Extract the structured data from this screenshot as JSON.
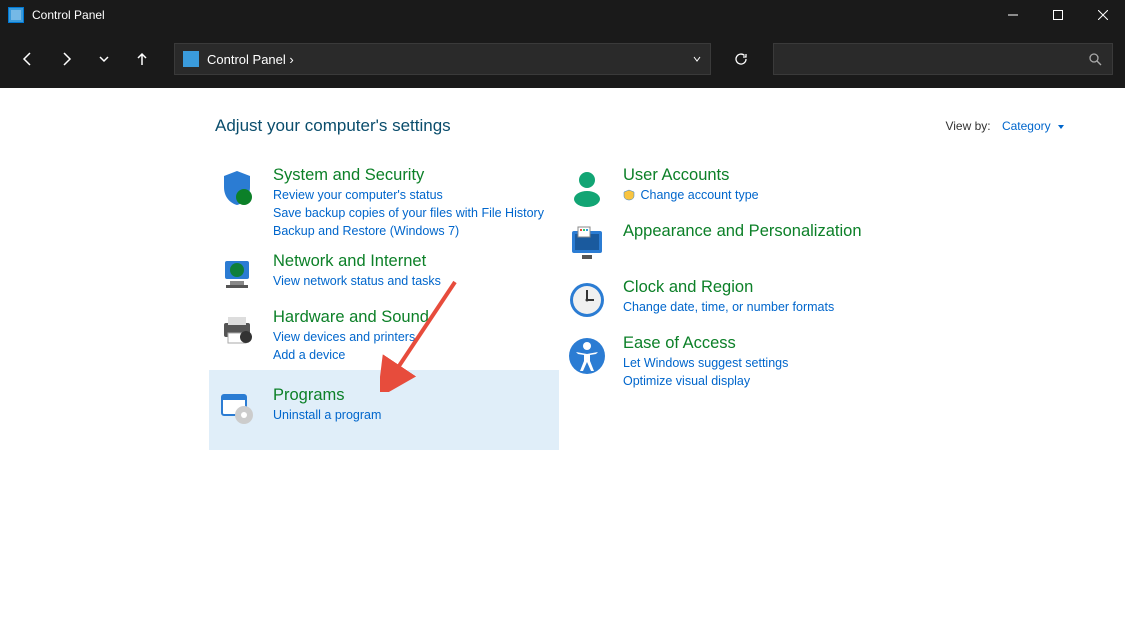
{
  "window": {
    "title": "Control Panel"
  },
  "breadcrumb": "Control Panel  ›",
  "heading": "Adjust your computer's settings",
  "viewby": {
    "label": "View by:",
    "value": "Category"
  },
  "left_column": [
    {
      "title": "System and Security",
      "links": [
        "Review your computer's status",
        "Save backup copies of your files with File History",
        "Backup and Restore (Windows 7)"
      ]
    },
    {
      "title": "Network and Internet",
      "links": [
        "View network status and tasks"
      ]
    },
    {
      "title": "Hardware and Sound",
      "links": [
        "View devices and printers",
        "Add a device"
      ]
    },
    {
      "title": "Programs",
      "links": [
        "Uninstall a program"
      ]
    }
  ],
  "right_column": [
    {
      "title": "User Accounts",
      "links": [
        "Change account type"
      ]
    },
    {
      "title": "Appearance and Personalization",
      "links": []
    },
    {
      "title": "Clock and Region",
      "links": [
        "Change date, time, or number formats"
      ]
    },
    {
      "title": "Ease of Access",
      "links": [
        "Let Windows suggest settings",
        "Optimize visual display"
      ]
    }
  ]
}
